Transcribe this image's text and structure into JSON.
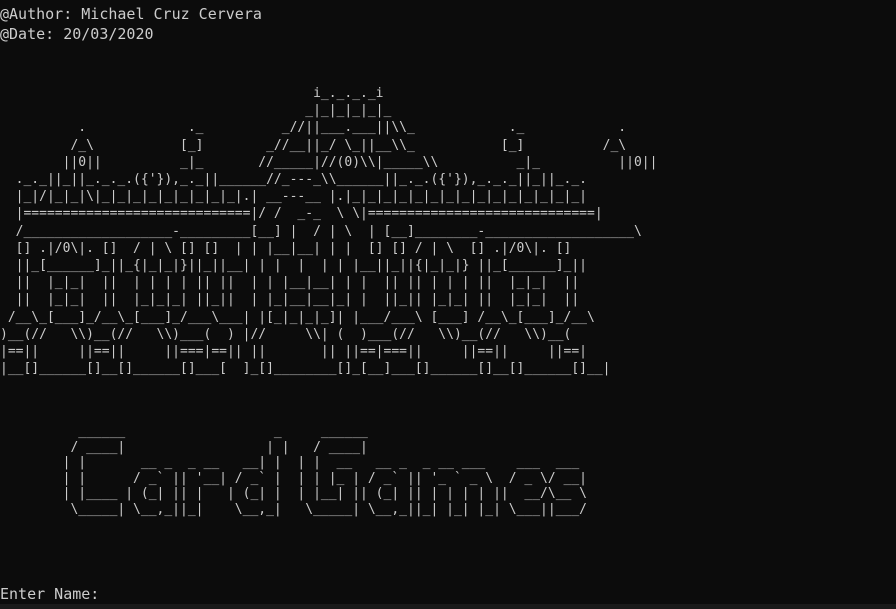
{
  "header": {
    "author_line": "@Author: Michael Cruz Cervera",
    "date_line": "@Date: 20/03/2020"
  },
  "art": {
    "castle": "                                        i_._._._i\n                                       _|_|_|_|_|_\n          .             ._          _//||___.___||\\\\_            ._            .\n         /_\\           [_]        _//__||_/ \\_||__\\\\_           [_]          /_\\\n        ||0||          _|_       //_____|//(0)\\\\|_____\\\\          _|_          ||0||\n  ._._||_||_._._.({'}),_._||______//_---_\\\\______||_._.({'}),_._._||_||_._.\n  |_|/|_|_|\\|_|_|_|_|_|_|_|_|_|.| __---__ |.|_|_|_|_|_|_|_|_|_|_|_|_|_|_|_|\n  |=============================|/ /  _-_  \\ \\|=============================|\n  /___________________-_________[__] |  / | \\  | [__]________-___________________\\\n  [] .|/0\\|. []  / | \\ [] []  | | |__|__| | |  [] [] / | \\  [] .|/0\\|. []\n  ||_[______]_||_{|_|_|}||_||__| | |  |  | | |__||_||{|_|_|} ||_[______]_||\n  ||  |_|_|  ||  | | | | || ||  | | |__|__| | |  || || | | | ||  |_|_|  ||\n  ||  |_|_|  ||  |_|_|_| ||_||  | |_|__|__|_| |  ||_|| |_|_| ||  |_|_|  ||\n /__\\_[___]_/__\\_[___]_/___\\___| |[_|_|_|_]| |___/___\\ [___] /__\\_[___]_/__\\\n)__(//   \\\\)__(//   \\\\)___(  ) |//     \\\\| (  )___(//   \\\\)__(//   \\\\)__(\n|==||     ||==||     ||===|==|| ||       || ||==|===||     ||==||     ||==|\n|__[]______[]__[]______[]___[  ]_[]________[]_[__]___[]______[]__[]______[]__|",
    "title": "          ______                   _     ______\n         / ____|                  | |   / ____|\n        | |       __ _  _ __   __| |  | |  __   __ _  _ __ ___    ___  ___\n        | |      / _` || '__| / _` |  | | |_ | / _` || '_ ` _ \\  / _ \\/ __|\n        | |____ | (_| || |   | (_| |  | |__| || (_| || | | | | ||  __/\\__ \\\n         \\_____| \\__,_||_|    \\__,_|   \\_____| \\__,_||_| |_| |_| \\___||___/"
  },
  "prompt": {
    "label": "Enter Name:",
    "value": ""
  },
  "colors": {
    "background": "#0c0c0c",
    "foreground": "#cccccc"
  }
}
